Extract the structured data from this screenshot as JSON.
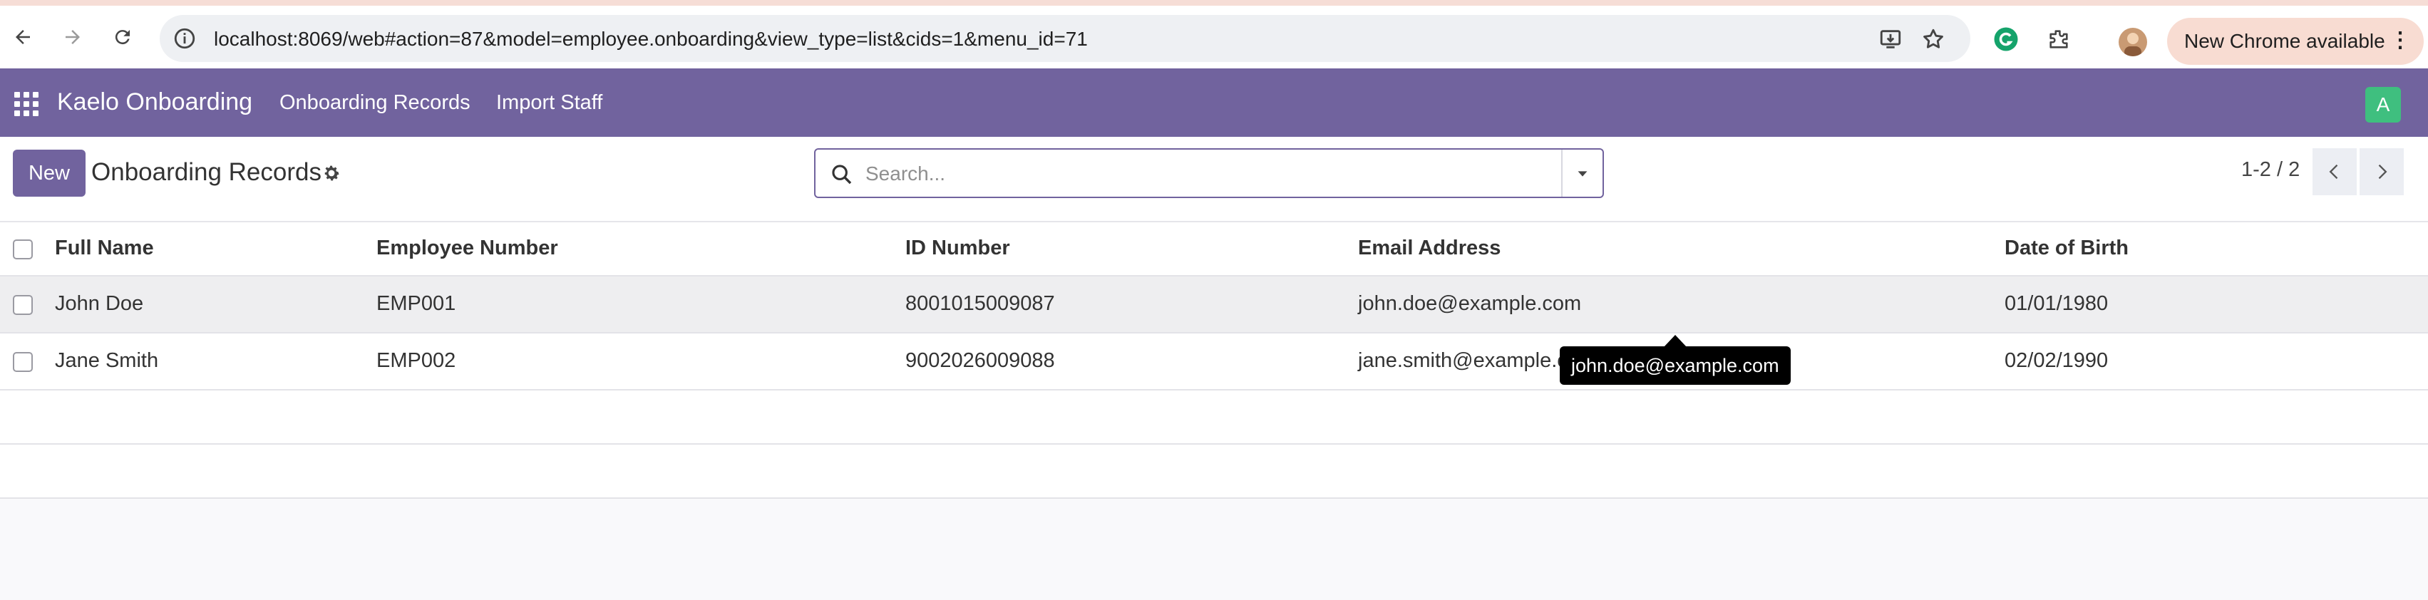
{
  "browser": {
    "url": "localhost:8069/web#action=87&model=employee.onboarding&view_type=list&cids=1&menu_id=71",
    "update_label": "New Chrome available"
  },
  "topnav": {
    "brand": "Kaelo Onboarding",
    "menu": [
      "Onboarding Records",
      "Import Staff"
    ],
    "user_initial": "A",
    "bar_color": "#71639e",
    "avatar_color": "#3fbf7f"
  },
  "control": {
    "new_label": "New",
    "title": "Onboarding Records",
    "search_placeholder": "Search...",
    "pager": "1-2 / 2"
  },
  "table": {
    "columns": [
      "Full Name",
      "Employee Number",
      "ID Number",
      "Email Address",
      "Date of Birth"
    ],
    "rows": [
      [
        "John Doe",
        "EMP001",
        "8001015009087",
        "john.doe@example.com",
        "01/01/1980"
      ],
      [
        "Jane Smith",
        "EMP002",
        "9002026009088",
        "jane.smith@example.com",
        "02/02/1990"
      ]
    ]
  },
  "tooltip": {
    "text": "john.doe@example.com"
  }
}
